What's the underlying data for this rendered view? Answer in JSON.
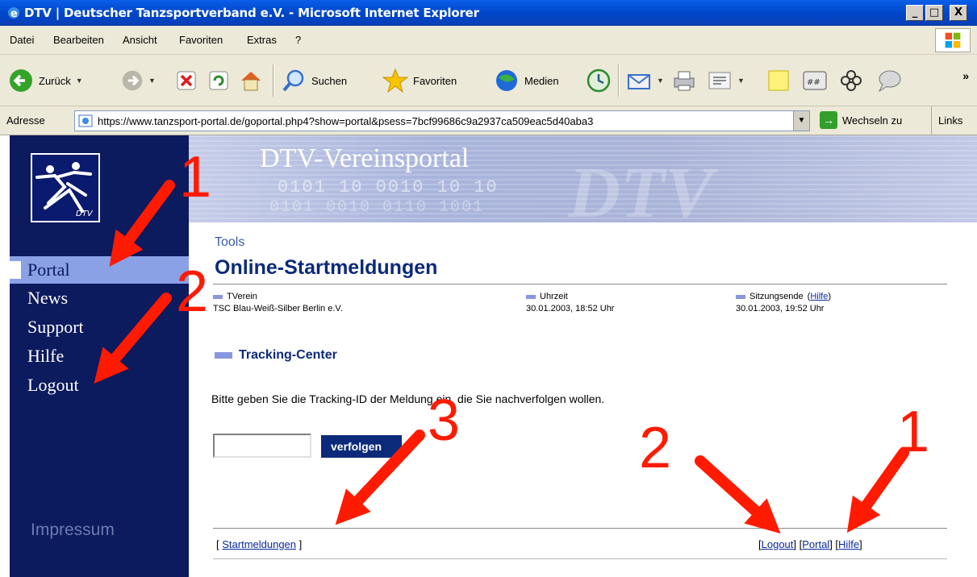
{
  "window": {
    "title": "DTV | Deutscher Tanzsportverband e.V. - Microsoft Internet Explorer",
    "minimize": "_",
    "maximize": "□",
    "close": "X"
  },
  "menu": {
    "items": [
      {
        "label": "Datei"
      },
      {
        "label": "Bearbeiten"
      },
      {
        "label": "Ansicht"
      },
      {
        "label": "Favoriten"
      },
      {
        "label": "Extras"
      },
      {
        "label": "?"
      }
    ]
  },
  "toolbar": {
    "back": "Zurück",
    "search": "Suchen",
    "favorites": "Favoriten",
    "media": "Medien",
    "more": "»"
  },
  "address": {
    "label": "Adresse",
    "url": "https://www.tanzsport-portal.de/goportal.php4?show=portal&psess=7bcf99686c9a2937ca509eac5d40aba3",
    "go": "Wechseln zu",
    "links": "Links"
  },
  "sidebar": {
    "logo_text": "DTV",
    "items": [
      {
        "label": "Portal",
        "active": true
      },
      {
        "label": "News"
      },
      {
        "label": "Support"
      },
      {
        "label": "Hilfe"
      },
      {
        "label": "Logout"
      }
    ],
    "impressum": "Impressum"
  },
  "banner": {
    "title": "DTV-Vereinsportal",
    "bits": "0101  10  0010 10  10",
    "bits2": "0101 0010  0110 1001",
    "watermark": "DTV"
  },
  "page": {
    "section": "Tools",
    "title": "Online-Startmeldungen",
    "info": [
      {
        "label": "TVerein",
        "value": "TSC Blau-Weiß-Silber Berlin e.V."
      },
      {
        "label": "Uhrzeit",
        "value": "30.01.2003, 18:52 Uhr"
      },
      {
        "label": "Sitzungsende",
        "help": "Hilfe",
        "value": "30.01.2003, 19:52 Uhr"
      }
    ],
    "tracking_title": "Tracking-Center",
    "instruction": "Bitte geben Sie die Tracking-ID der Meldung ein, die Sie nachverfolgen wollen.",
    "input_value": "",
    "button": "verfolgen"
  },
  "footer": {
    "startmeldungen": "Startmeldungen",
    "logout": "Logout",
    "portal": "Portal",
    "hilfe": "Hilfe"
  },
  "annotations": {
    "label_1_sidebar": "1",
    "label_2_sidebar": "2",
    "label_3_footer": "3",
    "label_2_footer": "2",
    "label_1_footer": "1",
    "arrow_color": "#ff1a00"
  }
}
